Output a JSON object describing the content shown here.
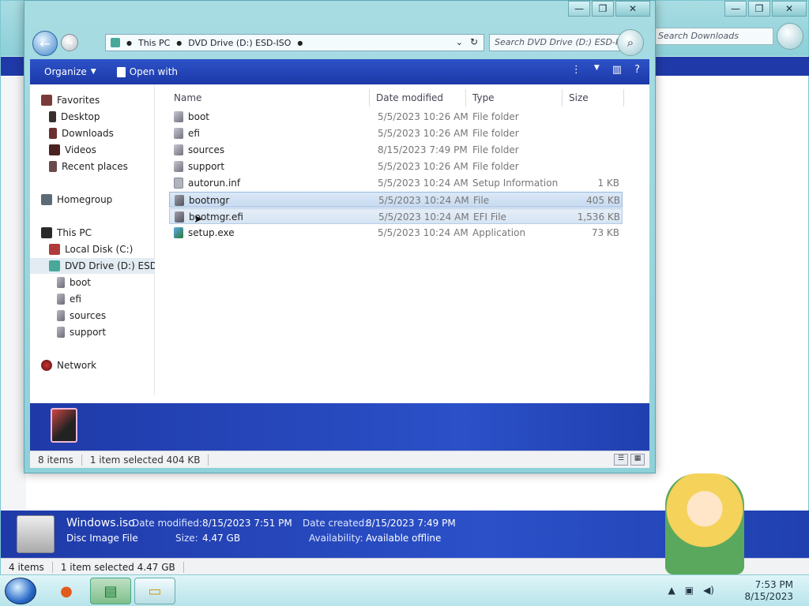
{
  "back_window": {
    "search_placeholder": "Search Downloads",
    "status": {
      "items": "4 items",
      "selected": "1 item selected  4.47 GB"
    },
    "details": {
      "name": "Windows.iso",
      "type": "Disc Image File",
      "date_modified_label": "Date modified:",
      "date_modified": "8/15/2023 7:51 PM",
      "date_created_label": "Date created:",
      "date_created": "8/15/2023 7:49 PM",
      "size_label": "Size:",
      "size": "4.47 GB",
      "availability_label": "Availability:",
      "availability": "Available offline"
    }
  },
  "window": {
    "address": {
      "segments": [
        "This PC",
        "DVD Drive (D:) ESD-ISO"
      ]
    },
    "search_placeholder": "Search DVD Drive (D:) ESD-I...",
    "toolbar": {
      "organize": "Organize",
      "open_with": "Open with"
    },
    "nav": {
      "favorites": "Favorites",
      "desktop": "Desktop",
      "downloads": "Downloads",
      "videos": "Videos",
      "recent": "Recent places",
      "homegroup": "Homegroup",
      "thispc": "This PC",
      "localdisk": "Local Disk (C:)",
      "dvd": "DVD Drive (D:) ESD-IS",
      "sub": [
        "boot",
        "efi",
        "sources",
        "support"
      ],
      "network": "Network"
    },
    "columns": {
      "name": "Name",
      "date": "Date modified",
      "type": "Type",
      "size": "Size"
    },
    "files": [
      {
        "name": "boot",
        "date": "5/5/2023 10:26 AM",
        "type": "File folder",
        "size": ""
      },
      {
        "name": "efi",
        "date": "5/5/2023 10:26 AM",
        "type": "File folder",
        "size": ""
      },
      {
        "name": "sources",
        "date": "8/15/2023 7:49 PM",
        "type": "File folder",
        "size": ""
      },
      {
        "name": "support",
        "date": "5/5/2023 10:26 AM",
        "type": "File folder",
        "size": ""
      },
      {
        "name": "autorun.inf",
        "date": "5/5/2023 10:24 AM",
        "type": "Setup Information",
        "size": "1 KB"
      },
      {
        "name": "bootmgr",
        "date": "5/5/2023 10:24 AM",
        "type": "File",
        "size": "405 KB"
      },
      {
        "name": "bootmgr.efi",
        "date": "5/5/2023 10:24 AM",
        "type": "EFI File",
        "size": "1,536 KB"
      },
      {
        "name": "setup.exe",
        "date": "5/5/2023 10:24 AM",
        "type": "Application",
        "size": "73 KB"
      }
    ],
    "status": {
      "items": "8 items",
      "selected": "1 item selected  404 KB"
    }
  },
  "taskbar": {
    "time": "7:53 PM",
    "date": "8/15/2023"
  },
  "icons": {
    "back": "back-arrow-icon",
    "forward": "forward-arrow-icon",
    "search": "search-icon",
    "help": "help-icon"
  }
}
